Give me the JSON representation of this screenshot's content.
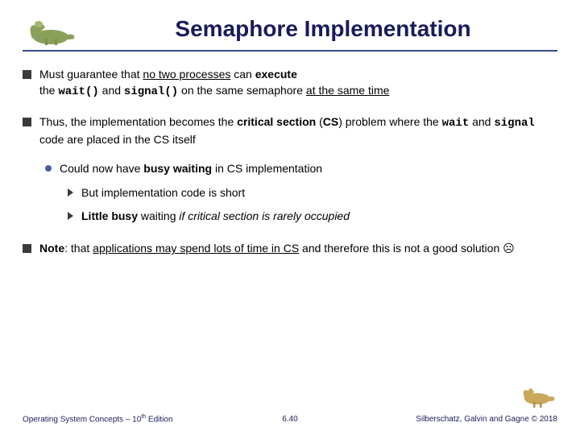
{
  "title": "Semaphore Implementation",
  "bullet1": {
    "p1": "Must guarantee that ",
    "u1": "no two processes",
    "p2": " can ",
    "b1": "execute",
    "p3": " the ",
    "c1": "wait()",
    "p4": " and ",
    "c2": "signal()",
    "p5": " on the same semaphore ",
    "u2": "at the same time"
  },
  "bullet2": {
    "p1": "Thus, the implementation becomes the ",
    "b1": "critical section",
    "p2": " (",
    "b2": "CS",
    "p3": ") problem where the ",
    "c1": "wait",
    "p4": " and ",
    "c2": "signal",
    "p5": " code are placed in the CS itself"
  },
  "sub1": {
    "p1": "Could now have ",
    "b1": "busy waiting",
    "p2": " in CS implementation"
  },
  "sub2a": "But implementation code is short",
  "sub2b": {
    "b1": "Little busy",
    "p1": " waiting ",
    "i1": "if critical section is rarely occupied"
  },
  "bullet3": {
    "b1": "Note",
    "p1": ": that ",
    "u1": "applications may spend lots of time in CS",
    "p2": " and therefore this is not a good solution ☹"
  },
  "footer": {
    "left1": "Operating System Concepts – 10",
    "left2": "th",
    "left3": " Edition",
    "center": "6.40",
    "right1": "Silberschatz, Galvin and Gagne ",
    "right2": "©",
    "right3": " 2018"
  }
}
